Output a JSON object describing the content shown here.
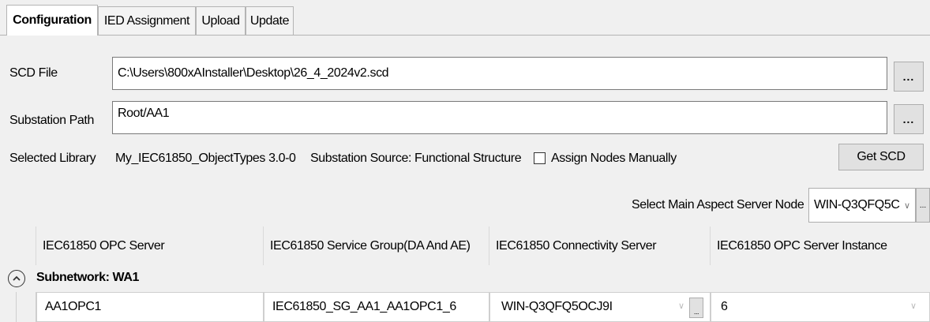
{
  "tabs": [
    {
      "label": "Configuration",
      "active": true
    },
    {
      "label": "IED Assignment",
      "active": false
    },
    {
      "label": "Upload",
      "active": false
    },
    {
      "label": "Update",
      "active": false
    }
  ],
  "config": {
    "scd_file_label": "SCD File",
    "scd_file_value": "C:\\Users\\800xAInstaller\\Desktop\\26_4_2024v2.scd",
    "substation_path_label": "Substation Path",
    "substation_path_value": "Root/AA1",
    "browse_label": "...",
    "selected_library_label": "Selected Library",
    "selected_library_value": "My_IEC61850_ObjectTypes 3.0-0",
    "substation_source": "Substation Source: Functional Structure",
    "assign_nodes_label": "Assign Nodes Manually",
    "assign_nodes_checked": false,
    "get_scd_label": "Get SCD",
    "main_aspect_label": "Select Main Aspect Server Node",
    "main_aspect_value": "WIN-Q3QFQ5C"
  },
  "grid": {
    "columns": [
      "IEC61850 OPC Server",
      "IEC61850 Service Group(DA And AE)",
      "IEC61850 Connectivity Server",
      "IEC61850 OPC Server Instance"
    ],
    "group_label": "Subnetwork: WA1",
    "rows": [
      {
        "opc_server": "AA1OPC1",
        "service_group": "IEC61850_SG_AA1_AA1OPC1_6",
        "connectivity_server": "WIN-Q3QFQ5OCJ9I",
        "instance": "6"
      }
    ]
  },
  "colors": {
    "background": "#f0f0f0",
    "border": "#7a7a7a"
  }
}
